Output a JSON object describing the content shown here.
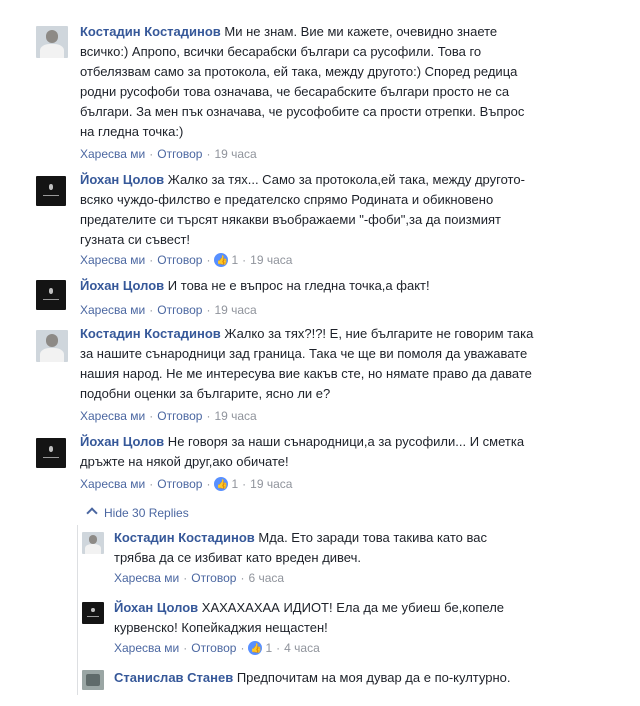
{
  "comments": [
    {
      "author": "Костадин Костадинов",
      "text_lines": [
        " Ми не знам. Вие ми кажете, очевидно знаете",
        "всичко:) Апропо, всички бесарабски българи са русофили. Това го",
        "отбелязвам само за протокола, ей така, между другото:) Според редица",
        "родни русофоби това означава, че бесарабските българи просто не са",
        "българи. За мен пък означава, че русофобите са прости отрепки. Въпрос",
        "на гледна точка:)"
      ],
      "like": "Харесва ми",
      "reply": "Отговор",
      "time": "19 часа"
    },
    {
      "author": "Йохан Цолов",
      "text_lines": [
        " Жалко за тях... Само за протокола,ей така, между другото-",
        "всяко чуждо-филство е предателско спрямо Родината и обикновено",
        "предателите си търсят някакви въображаеми \"-фоби\",за да поизмият",
        "гузната си съвест!"
      ],
      "like": "Харесва ми",
      "reply": "Отговор",
      "reactions": "1",
      "time": "19 часа"
    },
    {
      "author": "Йохан Цолов",
      "text_lines": [
        " И това не е въпрос на гледна точка,а факт!"
      ],
      "like": "Харесва ми",
      "reply": "Отговор",
      "time": "19 часа"
    },
    {
      "author": "Костадин Костадинов",
      "text_lines": [
        " Жалко за тях?!?! Е, ние българите не говорим така",
        "за нашите сънародници зад граница. Така че ще ви помоля да уважавате",
        "нашия народ. Не ме интересува вие какъв сте, но нямате право да давате",
        "подобни оценки за българите, ясно ли е?"
      ],
      "like": "Харесва ми",
      "reply": "Отговор",
      "time": "19 часа"
    },
    {
      "author": "Йохан Цолов",
      "text_lines": [
        " Не говоря за наши сънародници,а за русофили... И сметка",
        "дръжте на някой друг,ако обичате!"
      ],
      "like": "Харесва ми",
      "reply": "Отговор",
      "reactions": "1",
      "time": "19 часа"
    }
  ],
  "hide_replies_label": "Hide 30 Replies",
  "replies": [
    {
      "author": "Костадин Костадинов",
      "text_lines": [
        " Мда. Ето заради това такива като вас",
        "трябва да се избиват като вреден дивеч."
      ],
      "like": "Харесва ми",
      "reply": "Отговор",
      "time": "6 часа"
    },
    {
      "author": "Йохан Цолов",
      "text_lines": [
        " ХАХАХАХАА ИДИОТ! Ела да ме убиеш бе,копеле",
        "курвенско! Копейкаджия нещастен!"
      ],
      "like": "Харесва ми",
      "reply": "Отговор",
      "reactions": "1",
      "time": "4 часа"
    },
    {
      "author": "Станислав Станев",
      "text_lines": [
        " Предпочитам на моя дувар да е по-културно."
      ]
    }
  ],
  "colors": {
    "author": "#365899",
    "link": "#4b67a1",
    "meta": "#90949c",
    "reaction": "#5890ff"
  }
}
